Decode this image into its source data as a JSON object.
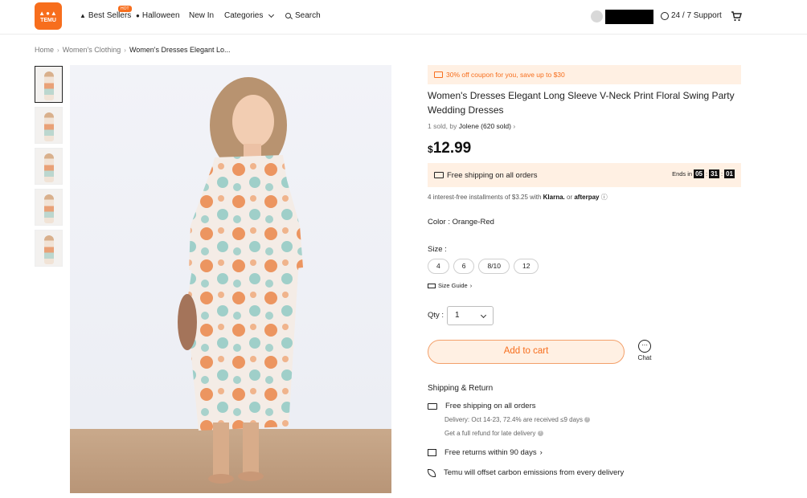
{
  "header": {
    "logo_text": "TEMU",
    "nav": {
      "best_sellers": "Best Sellers",
      "hot_badge": "HOT",
      "halloween": "Halloween",
      "new_in": "New In",
      "categories": "Categories",
      "search": "Search"
    },
    "support": "24 / 7 Support"
  },
  "breadcrumb": {
    "home": "Home",
    "category": "Women's Clothing",
    "current": "Women's Dresses Elegant Lo..."
  },
  "product": {
    "coupon": "30% off coupon for you, save up to $30",
    "title": "Women's Dresses Elegant Long Sleeve V-Neck Print Floral Swing Party Wedding Dresses",
    "sold_prefix": "1 sold, by",
    "store": "Jolene (620 sold)",
    "price_currency": "$",
    "price_value": "12.99",
    "shipping": "Free shipping on all orders",
    "ends_label": "Ends in",
    "timer": {
      "h": "05",
      "m": "31",
      "s": "01"
    },
    "installments_text": "4 interest-free installments of $3.25 with",
    "klarna": "Klarna.",
    "or": "or",
    "afterpay": "afterpay",
    "color_label": "Color :",
    "color_value": "Orange-Red",
    "size_label": "Size :",
    "sizes": [
      "4",
      "6",
      "8/10",
      "12"
    ],
    "size_guide": "Size Guide",
    "qty_label": "Qty :",
    "qty_value": "1",
    "add_to_cart": "Add to cart",
    "chat": "Chat"
  },
  "shipping_return": {
    "title": "Shipping & Return",
    "free_shipping": "Free shipping on all orders",
    "delivery": "Delivery: Oct 14-23, 72.4% are received ≤9 days",
    "refund": "Get a full refund for late delivery",
    "returns": "Free returns within 90 days",
    "carbon": "Temu will offset carbon emissions from every delivery"
  },
  "colors": {
    "brand_orange": "#f76e1d",
    "coupon_bg": "#fff0e3"
  }
}
